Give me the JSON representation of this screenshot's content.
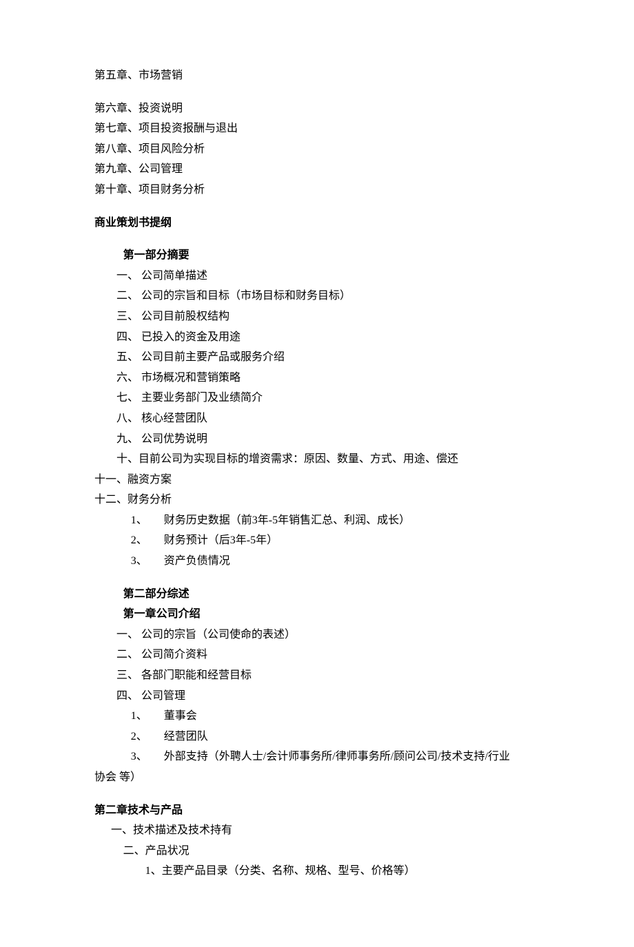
{
  "top_chapters_group1": [
    "第五章、市场营销"
  ],
  "top_chapters_group2": [
    "第六章、投资说明",
    "第七章、项目投资报酬与退出",
    "第八章、项目风险分析",
    "第九章、公司管理",
    "第十章、项目财务分析"
  ],
  "heading_plan_outline": "商业策划书提纲",
  "part1": {
    "title": "第一部分摘要",
    "items": [
      "一、 公司简单描述",
      "二、 公司的宗旨和目标（市场目标和财务目标）",
      "三、 公司目前股权结构",
      "四、 已投入的资金及用途",
      "五、 公司目前主要产品或服务介绍",
      "六、 市场概况和营销策略",
      "七、 主要业务部门及业绩简介",
      "八、 核心经营团队",
      "九、 公司优势说明",
      "十、目前公司为实现目标的增资需求：原因、数量、方式、用途、偿还"
    ],
    "items_outdent": [
      "十一、融资方案",
      "十二、财务分析"
    ],
    "sub_numbered": [
      "1、　　财务历史数据（前3年-5年销售汇总、利润、成长）",
      "2、　　财务预计（后3年-5年）",
      "3、　　资产负债情况"
    ]
  },
  "part2": {
    "title": "第二部分综述",
    "chapter1": {
      "title": "第一章公司介绍",
      "items": [
        "一、 公司的宗旨（公司使命的表述）",
        "二、 公司简介资料",
        "三、 各部门职能和经营目标",
        "四、 公司管理"
      ],
      "sub_numbered": [
        "1、　　董事会",
        "2、　　经营团队",
        "3、　　外部支持（外聘人士/会计师事务所/律师事务所/顾问公司/技术支持/行业"
      ],
      "sub_numbered_tail": "协会 等）"
    }
  },
  "chapter2": {
    "title": "第二章技术与产品",
    "lvl1": "一、技术描述及技术持有",
    "lvl2": "二、产品状况",
    "lvl3": "1、主要产品目录（分类、名称、规格、型号、价格等）"
  }
}
